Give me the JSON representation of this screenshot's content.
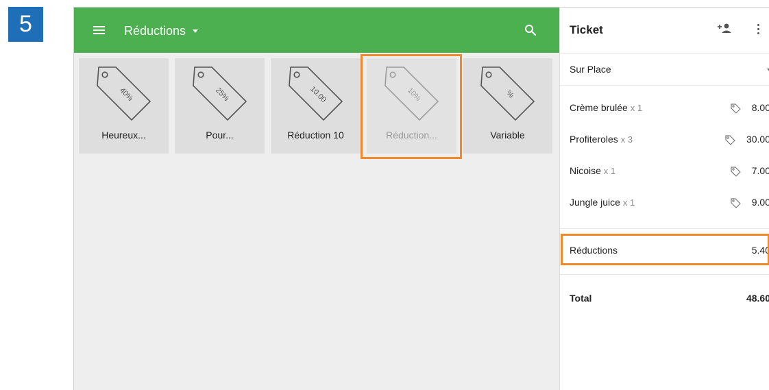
{
  "step_number": "5",
  "toolbar": {
    "category": "Réductions"
  },
  "discounts": [
    {
      "tag_text": "40%",
      "label": "Heureux..."
    },
    {
      "tag_text": "25%",
      "label": "Pour..."
    },
    {
      "tag_text": "10.00",
      "label": "Réduction 10"
    },
    {
      "tag_text": "10%",
      "label": "Réduction..."
    },
    {
      "tag_text": "%",
      "label": "Variable"
    }
  ],
  "ticket": {
    "title": "Ticket",
    "dining_option": "Sur Place",
    "items": [
      {
        "name": "Crème brulée",
        "qty": "x 1",
        "price": "8.00"
      },
      {
        "name": "Profiteroles",
        "qty": "x 3",
        "price": "30.00"
      },
      {
        "name": "Nicoise",
        "qty": "x 1",
        "price": "7.00"
      },
      {
        "name": "Jungle juice",
        "qty": "x 1",
        "price": "9.00"
      }
    ],
    "discounts_label": "Réductions",
    "discounts_value": "5.40",
    "total_label": "Total",
    "total_value": "48.60"
  },
  "colors": {
    "toolbar": "#4caf50",
    "highlight": "#ef8a2c",
    "step_badge": "#1f6fb8"
  },
  "icons": [
    "menu-icon",
    "chevron-down-icon",
    "search-icon",
    "add-customer-icon",
    "more-vert-icon",
    "price-tag-icon"
  ]
}
